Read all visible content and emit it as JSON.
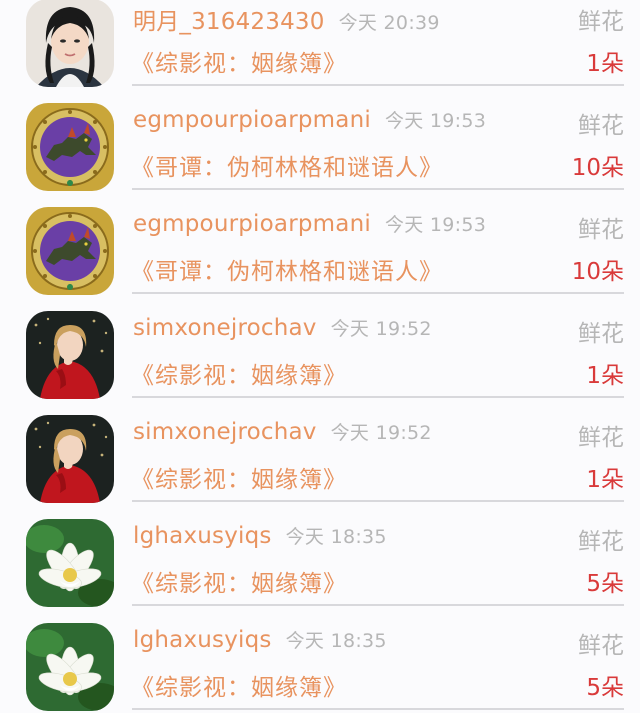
{
  "rows": [
    {
      "user": "明月_316423430",
      "time": "今天 20:39",
      "gift_type": "鲜花",
      "book": "《综影视：姻缘簿》",
      "count": "1朵",
      "avatar": "girl-portrait"
    },
    {
      "user": "egmpourpioarpmani",
      "time": "今天 19:53",
      "gift_type": "鲜花",
      "book": "《哥谭：伪柯林格和谜语人》",
      "count": "10朵",
      "avatar": "beast-emblem"
    },
    {
      "user": "egmpourpioarpmani",
      "time": "今天 19:53",
      "gift_type": "鲜花",
      "book": "《哥谭：伪柯林格和谜语人》",
      "count": "10朵",
      "avatar": "beast-emblem"
    },
    {
      "user": "simxonejrochav",
      "time": "今天 19:52",
      "gift_type": "鲜花",
      "book": "《综影视：姻缘簿》",
      "count": "1朵",
      "avatar": "red-sweater-photo"
    },
    {
      "user": "simxonejrochav",
      "time": "今天 19:52",
      "gift_type": "鲜花",
      "book": "《综影视：姻缘簿》",
      "count": "1朵",
      "avatar": "red-sweater-photo"
    },
    {
      "user": "lghaxusyiqs",
      "time": "今天 18:35",
      "gift_type": "鲜花",
      "book": "《综影视：姻缘簿》",
      "count": "5朵",
      "avatar": "white-lotus"
    },
    {
      "user": "lghaxusyiqs",
      "time": "今天 18:35",
      "gift_type": "鲜花",
      "book": "《综影视：姻缘簿》",
      "count": "5朵",
      "avatar": "white-lotus"
    }
  ]
}
